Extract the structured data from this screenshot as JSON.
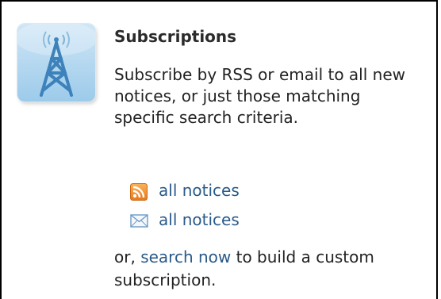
{
  "widget": {
    "icon": "radio-tower-icon",
    "title": "Subscriptions",
    "description": "Subscribe by RSS or email to all new notices, or just those matching specific search criteria.",
    "feeds": [
      {
        "icon": "rss-icon",
        "label": "all notices"
      },
      {
        "icon": "email-icon",
        "label": "all notices"
      }
    ],
    "footer": {
      "prefix": "or, ",
      "link_label": "search now",
      "suffix": " to build a custom subscription."
    },
    "colors": {
      "link": "#2a5a8a",
      "rss": "#f08a24",
      "tile": "#b6d8f0"
    }
  }
}
